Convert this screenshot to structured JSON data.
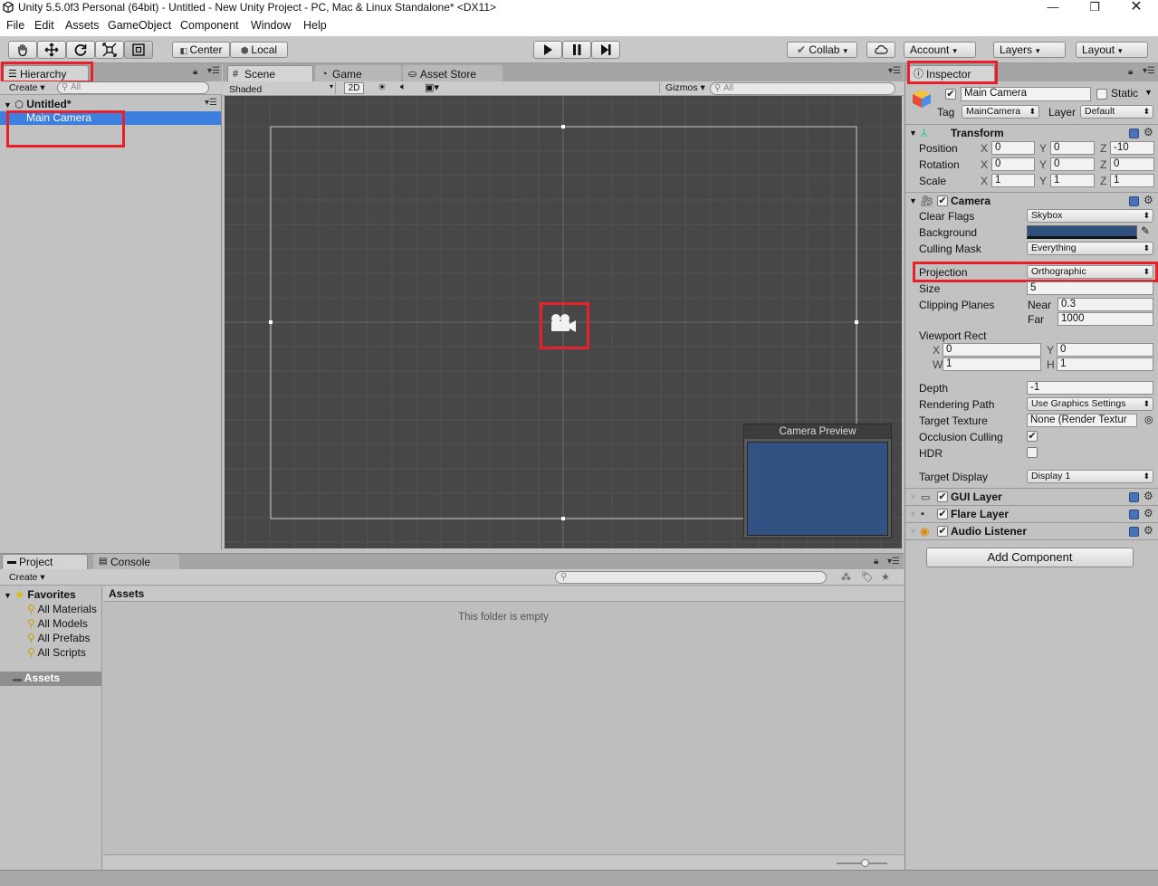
{
  "window": {
    "title": "Unity 5.5.0f3 Personal (64bit) - Untitled - New Unity Project - PC, Mac & Linux Standalone* <DX11>"
  },
  "menu": [
    "File",
    "Edit",
    "Assets",
    "GameObject",
    "Component",
    "Window",
    "Help"
  ],
  "toolbar": {
    "pivot": "Center",
    "space": "Local",
    "collab": "Collab",
    "account": "Account",
    "layers": "Layers",
    "layout": "Layout"
  },
  "hierarchy": {
    "tab": "Hierarchy",
    "create": "Create",
    "search_placeholder": "All",
    "scene": "Untitled*",
    "items": [
      "Main Camera"
    ]
  },
  "scene_view": {
    "tabs": [
      "Scene",
      "Game",
      "Asset Store"
    ],
    "shading": "Shaded",
    "mode_2d": "2D",
    "gizmos": "Gizmos",
    "search_placeholder": "All",
    "preview_title": "Camera Preview",
    "preview_color": "#315283",
    "bg_color": "#474747"
  },
  "project": {
    "tabs": [
      "Project",
      "Console"
    ],
    "create": "Create",
    "favorites": "Favorites",
    "favorite_items": [
      "All Materials",
      "All Models",
      "All Prefabs",
      "All Scripts"
    ],
    "assets_root": "Assets",
    "assets_header": "Assets",
    "empty_message": "This folder is empty"
  },
  "inspector": {
    "tab": "Inspector",
    "object_name": "Main Camera",
    "static_label": "Static",
    "tag_label": "Tag",
    "tag_value": "MainCamera",
    "layer_label": "Layer",
    "layer_value": "Default",
    "transform": {
      "title": "Transform",
      "position": {
        "label": "Position",
        "x": "0",
        "y": "0",
        "z": "-10"
      },
      "rotation": {
        "label": "Rotation",
        "x": "0",
        "y": "0",
        "z": "0"
      },
      "scale": {
        "label": "Scale",
        "x": "1",
        "y": "1",
        "z": "1"
      }
    },
    "camera": {
      "title": "Camera",
      "clear_flags": {
        "label": "Clear Flags",
        "value": "Skybox"
      },
      "background": {
        "label": "Background",
        "color": "#2f4f7f"
      },
      "culling_mask": {
        "label": "Culling Mask",
        "value": "Everything"
      },
      "projection": {
        "label": "Projection",
        "value": "Orthographic"
      },
      "size": {
        "label": "Size",
        "value": "5"
      },
      "clipping": {
        "label": "Clipping Planes",
        "near_label": "Near",
        "near": "0.3",
        "far_label": "Far",
        "far": "1000"
      },
      "viewport": {
        "label": "Viewport Rect",
        "x": "0",
        "y": "0",
        "w": "1",
        "h": "1"
      },
      "depth": {
        "label": "Depth",
        "value": "-1"
      },
      "rendering_path": {
        "label": "Rendering Path",
        "value": "Use Graphics Settings"
      },
      "target_texture": {
        "label": "Target Texture",
        "value": "None (Render Textur"
      },
      "occlusion": {
        "label": "Occlusion Culling",
        "checked": true
      },
      "hdr": {
        "label": "HDR",
        "checked": false
      },
      "target_display": {
        "label": "Target Display",
        "value": "Display 1"
      }
    },
    "components": [
      "GUI Layer",
      "Flare Layer",
      "Audio Listener"
    ],
    "add_component": "Add Component"
  },
  "labels": {
    "x": "X",
    "y": "Y",
    "z": "Z",
    "w": "W",
    "h": "H"
  }
}
